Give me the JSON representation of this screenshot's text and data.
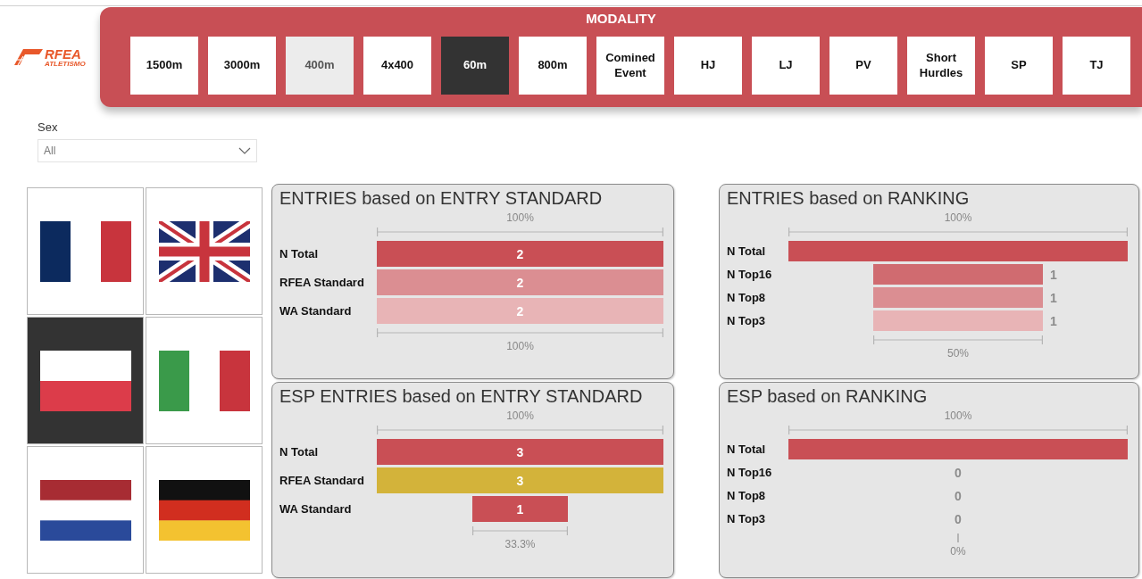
{
  "logo": {
    "text": "RFEA",
    "subtext": "ATLETISMO"
  },
  "modality": {
    "title": "MODALITY",
    "options": [
      {
        "label": "1500m",
        "selected": false,
        "disabled": false
      },
      {
        "label": "3000m",
        "selected": false,
        "disabled": false
      },
      {
        "label": "400m",
        "selected": false,
        "disabled": true
      },
      {
        "label": "4x400",
        "selected": false,
        "disabled": false
      },
      {
        "label": "60m",
        "selected": true,
        "disabled": false
      },
      {
        "label": "800m",
        "selected": false,
        "disabled": false
      },
      {
        "label": "Comined Event",
        "selected": false,
        "disabled": false
      },
      {
        "label": "HJ",
        "selected": false,
        "disabled": false
      },
      {
        "label": "LJ",
        "selected": false,
        "disabled": false
      },
      {
        "label": "PV",
        "selected": false,
        "disabled": false
      },
      {
        "label": "Short Hurdles",
        "selected": false,
        "disabled": false
      },
      {
        "label": "SP",
        "selected": false,
        "disabled": false
      },
      {
        "label": "TJ",
        "selected": false,
        "disabled": false
      }
    ]
  },
  "sex_filter": {
    "label": "Sex",
    "value": "All"
  },
  "countries": [
    {
      "selected": false
    },
    {
      "selected": false
    },
    {
      "selected": true
    },
    {
      "selected": false
    },
    {
      "selected": false
    },
    {
      "selected": false
    }
  ],
  "charts": [
    {
      "title": "ENTRIES based on ENTRY STANDARD",
      "top_label": "100%",
      "bottom_label": "100%",
      "labels_outside": false,
      "rows": [
        {
          "label": "N Total",
          "value": "2",
          "color": "#c94f55"
        },
        {
          "label": "RFEA Standard",
          "value": "2",
          "color": "#db8e92"
        },
        {
          "label": "WA Standard",
          "value": "2",
          "color": "#e8b4b6"
        }
      ]
    },
    {
      "title": "ENTRIES based on RANKING",
      "top_label": "100%",
      "bottom_label": "50%",
      "labels_outside": true,
      "rows": [
        {
          "label": "N Total",
          "color": "#c94f55"
        },
        {
          "label": "N Top16",
          "value": "1",
          "color": "#d06b70"
        },
        {
          "label": "N Top8",
          "value": "1",
          "color": "#db8e92"
        },
        {
          "label": "N Top3",
          "value": "1",
          "color": "#e8b4b6"
        }
      ]
    },
    {
      "title": "ESP ENTRIES based on ENTRY STANDARD",
      "top_label": "100%",
      "bottom_label": "33.3%",
      "labels_outside": false,
      "rows": [
        {
          "label": "N Total",
          "value": "3",
          "color": "#c94f55"
        },
        {
          "label": "RFEA Standard",
          "value": "3",
          "color": "#d3b33a"
        },
        {
          "label": "WA Standard",
          "value": "1",
          "color": "#c94f55"
        }
      ]
    },
    {
      "title": "ESP based on RANKING",
      "top_label": "100%",
      "bottom_label": "0%",
      "rows": [
        {
          "label": "N Total",
          "color": "#c94f55"
        },
        {
          "label": "N Top16",
          "value": "0"
        },
        {
          "label": "N Top8",
          "value": "0"
        },
        {
          "label": "N Top3",
          "value": "0"
        }
      ]
    }
  ]
}
